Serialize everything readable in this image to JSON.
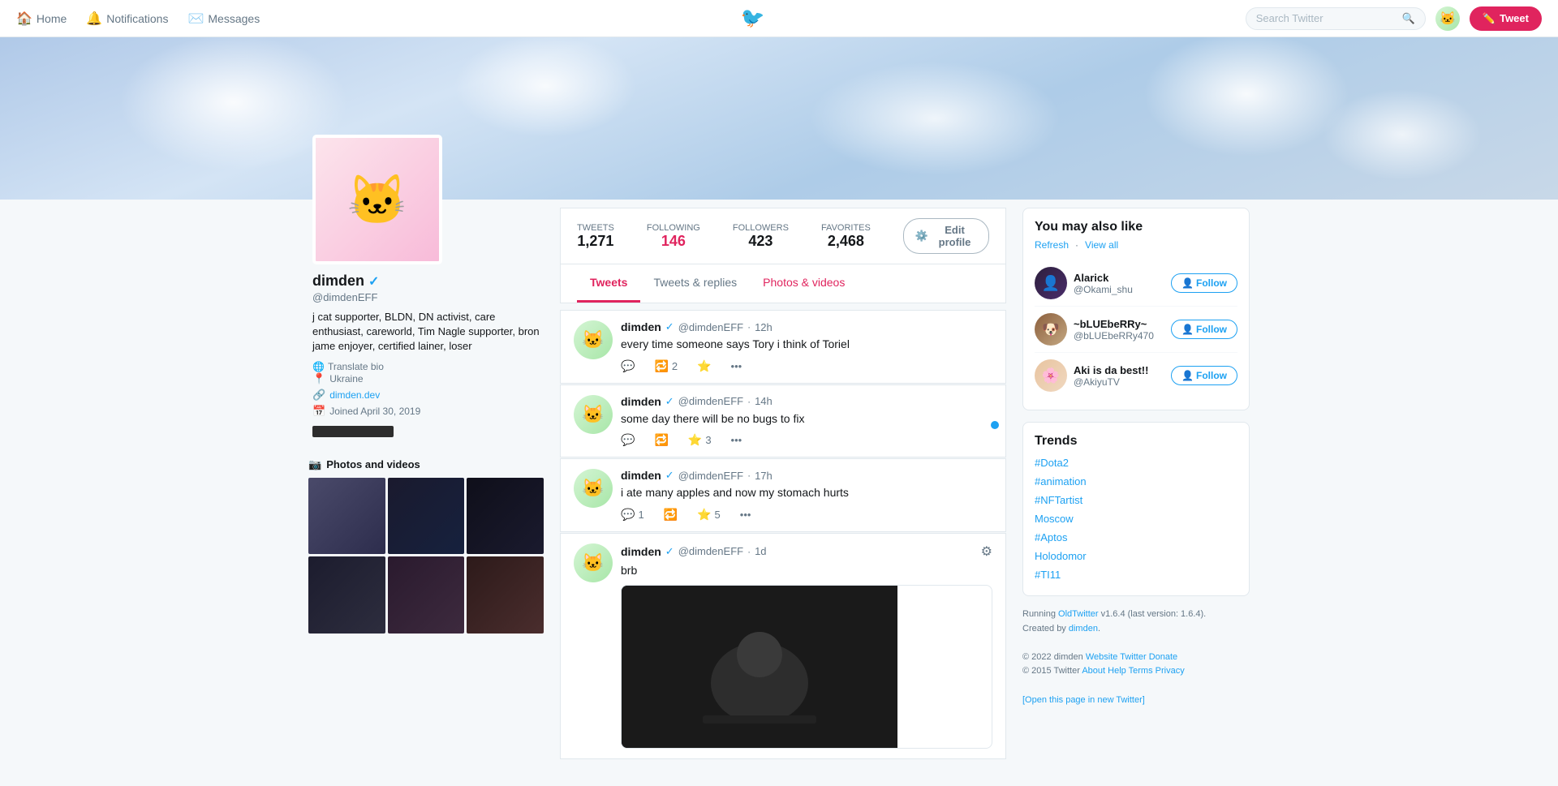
{
  "navbar": {
    "home_label": "Home",
    "notifications_label": "Notifications",
    "messages_label": "Messages",
    "search_placeholder": "Search Twitter",
    "tweet_button_label": "Tweet"
  },
  "profile": {
    "name": "dimden",
    "handle": "@dimdenEFF",
    "verified": true,
    "bio": "j cat supporter, BLDN, DN activist, care enthusiast, careworld, Tim Nagle supporter, bron jame enjoyer, certified lainer, loser",
    "location": "Ukraine",
    "website": "dimden.dev",
    "joined": "Joined April 30, 2019",
    "translate_label": "Translate bio"
  },
  "stats": {
    "tweets_label": "TWEETS",
    "tweets_value": "1,271",
    "following_label": "FOLLOWING",
    "following_value": "146",
    "followers_label": "FOLLOWERS",
    "followers_value": "423",
    "favorites_label": "FAVORITES",
    "favorites_value": "2,468"
  },
  "edit_profile_label": "Edit profile",
  "tabs": [
    {
      "id": "tweets",
      "label": "Tweets",
      "active": true
    },
    {
      "id": "replies",
      "label": "Tweets & replies",
      "active": false
    },
    {
      "id": "photos",
      "label": "Photos & videos",
      "active": false
    }
  ],
  "photos_section": {
    "title": "Photos and videos",
    "camera_icon": "📷"
  },
  "tweets": [
    {
      "id": 1,
      "name": "dimden",
      "handle": "@dimdenEFF",
      "time": "12h",
      "text": "every time someone says Tory i think of Toriel",
      "replies": "",
      "retweets": "2",
      "likes": "",
      "has_more": true
    },
    {
      "id": 2,
      "name": "dimden",
      "handle": "@dimdenEFF",
      "time": "14h",
      "text": "some day there will be no bugs to fix",
      "replies": "",
      "retweets": "",
      "likes": "3",
      "has_more": false
    },
    {
      "id": 3,
      "name": "dimden",
      "handle": "@dimdenEFF",
      "time": "17h",
      "text": "i ate many apples and now my stomach hurts",
      "replies": "1",
      "retweets": "",
      "likes": "5",
      "has_more": false
    },
    {
      "id": 4,
      "name": "dimden",
      "handle": "@dimdenEFF",
      "time": "1d",
      "text": "brb",
      "replies": "",
      "retweets": "",
      "likes": "",
      "has_media": true,
      "has_more": true
    }
  ],
  "you_may_like": {
    "title": "You may also like",
    "refresh_label": "Refresh",
    "view_all_label": "View all",
    "suggestions": [
      {
        "id": 1,
        "name": "Alarick",
        "handle": "@Okami_shu",
        "follow_label": "Follow"
      },
      {
        "id": 2,
        "name": "~bLUEbeRRy~",
        "handle": "@bLUEbeRRy470",
        "follow_label": "Follow"
      },
      {
        "id": 3,
        "name": "Aki is da best!!",
        "handle": "@AkiyuTV",
        "follow_label": "Follow"
      }
    ]
  },
  "trends": {
    "title": "Trends",
    "items": [
      "#Dota2",
      "#animation",
      "#NFTartist",
      "Moscow",
      "#Aptos",
      "Holodomor",
      "#TI11"
    ]
  },
  "footer": {
    "running_label": "Running",
    "old_twitter_label": "OldTwitter",
    "version": "v1.6.4 (last version: 1.6.4).",
    "created_by_label": "Created by",
    "creator": "dimden",
    "year1": "© 2022 dimden",
    "website_label": "Website",
    "twitter_label": "Twitter",
    "donate_label": "Donate",
    "year2": "© 2015 Twitter",
    "about_label": "About",
    "help_label": "Help",
    "terms_label": "Terms",
    "privacy_label": "Privacy",
    "open_new_label": "[Open this page in new Twitter]"
  }
}
